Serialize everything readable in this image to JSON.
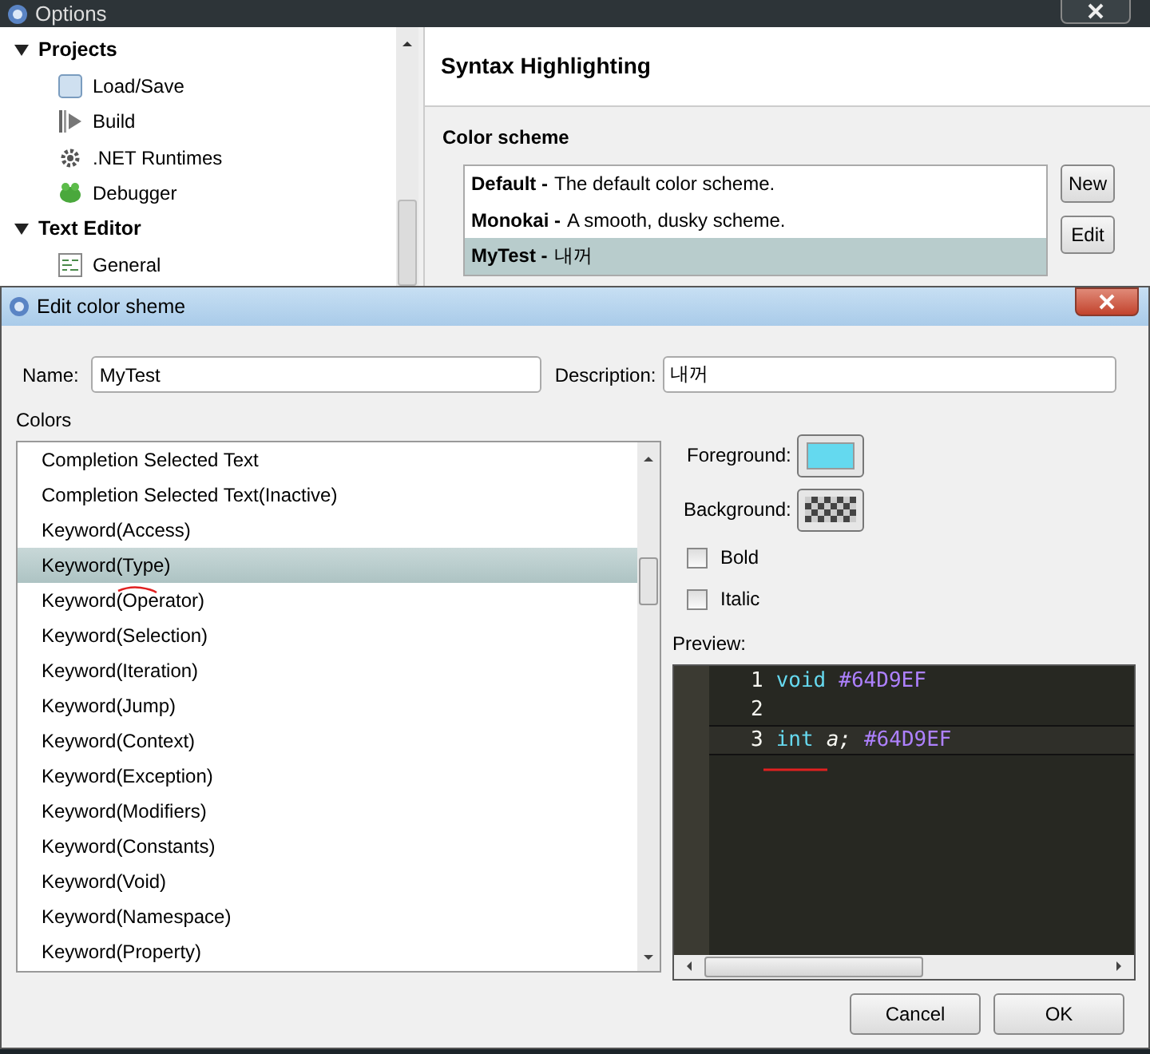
{
  "options_window": {
    "title": "Options",
    "tree": [
      {
        "label": "Projects",
        "expanded": true,
        "children": [
          {
            "label": "Load/Save"
          },
          {
            "label": "Build"
          },
          {
            "label": ".NET Runtimes"
          },
          {
            "label": "Debugger"
          }
        ]
      },
      {
        "label": "Text Editor",
        "expanded": true,
        "children": [
          {
            "label": "General"
          }
        ]
      }
    ],
    "heading": "Syntax Highlighting",
    "scheme_label": "Color scheme",
    "schemes": [
      {
        "name": "Default -",
        "description": "The default color scheme.",
        "selected": false
      },
      {
        "name": "Monokai -",
        "description": "A smooth, dusky scheme.",
        "selected": false
      },
      {
        "name": "MyTest -",
        "description": "내꺼",
        "selected": true
      }
    ],
    "buttons": [
      "New",
      "Edit"
    ]
  },
  "dialog": {
    "title": "Edit color sheme",
    "name_field": {
      "label": "Name:",
      "value": "MyTest"
    },
    "description_field": {
      "label": "Description:",
      "value": "내꺼"
    },
    "colors_label": "Colors",
    "colors": [
      {
        "label": "Completion Selected Text",
        "selected": false
      },
      {
        "label": "Completion Selected Text(Inactive)",
        "selected": false
      },
      {
        "label": "Keyword(Access)",
        "selected": false
      },
      {
        "label": "Keyword(Type)",
        "selected": true
      },
      {
        "label": "Keyword(Operator)",
        "selected": false
      },
      {
        "label": "Keyword(Selection)",
        "selected": false
      },
      {
        "label": "Keyword(Iteration)",
        "selected": false
      },
      {
        "label": "Keyword(Jump)",
        "selected": false
      },
      {
        "label": "Keyword(Context)",
        "selected": false
      },
      {
        "label": "Keyword(Exception)",
        "selected": false
      },
      {
        "label": "Keyword(Modifiers)",
        "selected": false
      },
      {
        "label": "Keyword(Constants)",
        "selected": false
      },
      {
        "label": "Keyword(Void)",
        "selected": false
      },
      {
        "label": "Keyword(Namespace)",
        "selected": false
      },
      {
        "label": "Keyword(Property)",
        "selected": false
      }
    ],
    "foreground": {
      "label": "Foreground:",
      "color": "#64d9ef"
    },
    "background": {
      "label": "Background:"
    },
    "bold": {
      "label": "Bold",
      "checked": false
    },
    "italic": {
      "label": "Italic",
      "checked": false
    },
    "preview_label": "Preview:",
    "preview": [
      {
        "number": "1",
        "current": false,
        "tokens": [
          {
            "text": "void",
            "color": "#66d9ef"
          },
          {
            "text": "#64D9EF",
            "color": "#ae81ff"
          }
        ]
      },
      {
        "number": "2",
        "current": false
      },
      {
        "number": "3",
        "current": true,
        "tokens": [
          {
            "text": "int",
            "color": "#66d9ef"
          },
          {
            "text": "a;",
            "color": "#f8f8f2"
          },
          {
            "text": "#64D9EF",
            "color": "#ae81ff"
          }
        ]
      }
    ],
    "buttons": [
      "Cancel",
      "OK"
    ]
  }
}
